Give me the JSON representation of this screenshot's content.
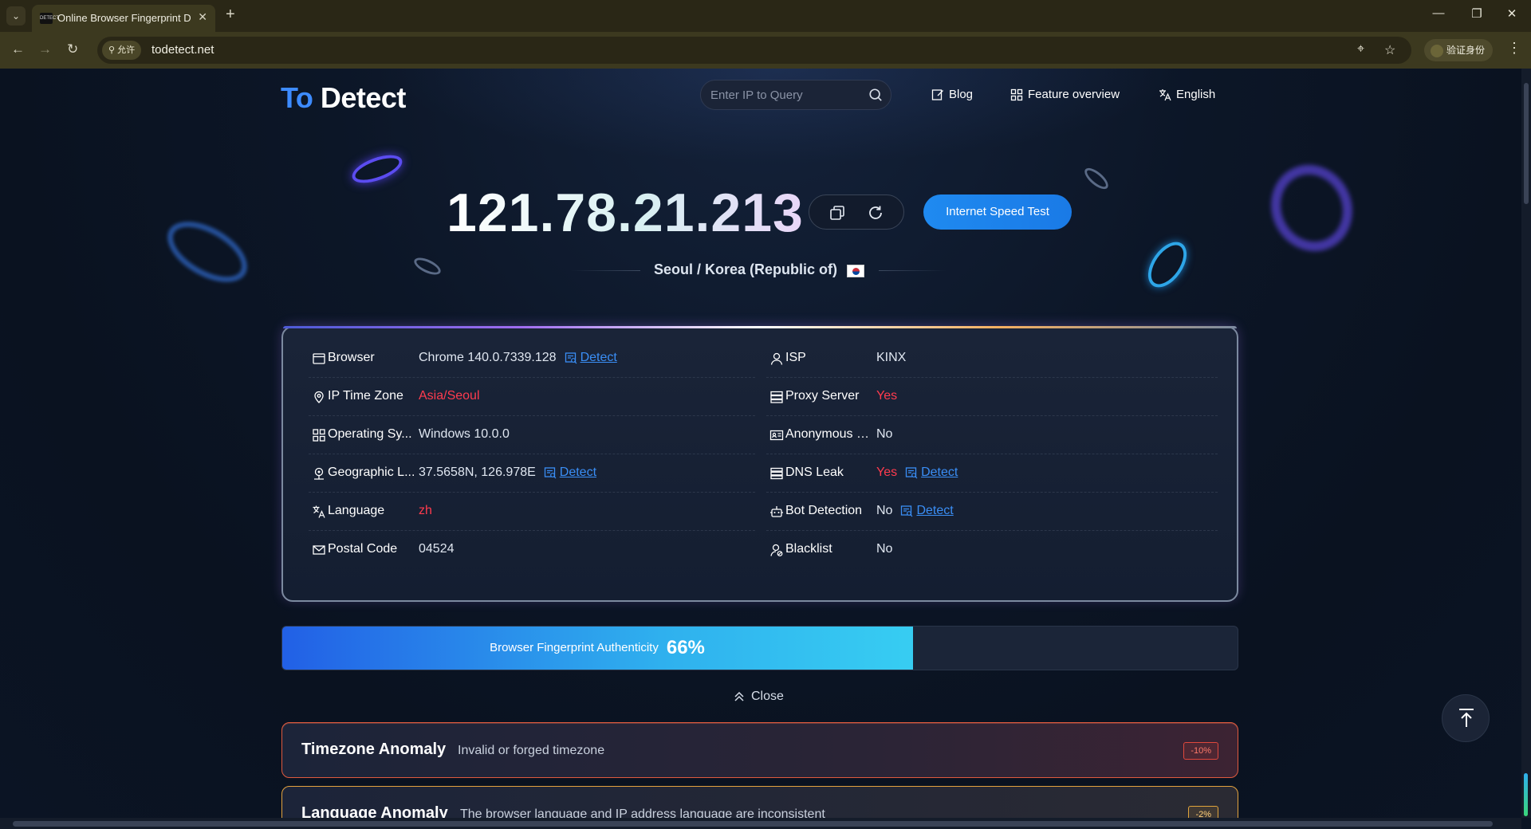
{
  "browser": {
    "tab_title": "Online Browser Fingerprint D",
    "tab_favicon_text": "DETECT",
    "site_permission": "允许",
    "url": "todetect.net",
    "verify_label": "验证身份"
  },
  "header": {
    "logo_to": "To",
    "logo_detect": "Detect",
    "search_placeholder": "Enter IP to Query",
    "nav": {
      "blog": "Blog",
      "features": "Feature overview",
      "language": "English"
    }
  },
  "hero": {
    "ip": "121.78.21.213",
    "location": "Seoul / Korea (Republic of)",
    "speed_test": "Internet Speed Test"
  },
  "info": {
    "left": [
      {
        "icon": "browser-icon",
        "label": "Browser",
        "value": "Chrome 140.0.7339.128",
        "detect": "Detect",
        "red": false
      },
      {
        "icon": "location-pin-icon",
        "label": "IP Time Zone",
        "value": "Asia/Seoul",
        "red": true
      },
      {
        "icon": "grid-icon",
        "label": "Operating Sy...",
        "value": "Windows 10.0.0",
        "red": false
      },
      {
        "icon": "map-pin-icon",
        "label": "Geographic L...",
        "value": "37.5658N, 126.978E",
        "detect": "Detect",
        "red": false
      },
      {
        "icon": "translate-icon",
        "label": "Language",
        "value": "zh",
        "red": true
      },
      {
        "icon": "mail-icon",
        "label": "Postal Code",
        "value": "04524",
        "red": false
      }
    ],
    "right": [
      {
        "icon": "user-icon",
        "label": "ISP",
        "value": "KINX",
        "red": false
      },
      {
        "icon": "server-icon",
        "label": "Proxy Server",
        "value": "Yes",
        "red": true
      },
      {
        "icon": "id-card-icon",
        "label": "Anonymous S...",
        "value": "No",
        "red": false
      },
      {
        "icon": "database-icon",
        "label": "DNS Leak",
        "value": "Yes",
        "detect": "Detect",
        "red": true
      },
      {
        "icon": "robot-icon",
        "label": "Bot Detection",
        "value": "No",
        "detect": "Detect",
        "red": false
      },
      {
        "icon": "user-block-icon",
        "label": "Blacklist",
        "value": "No",
        "red": false
      }
    ]
  },
  "authenticity": {
    "label": "Browser Fingerprint Authenticity",
    "percent_text": "66%",
    "percent": 66
  },
  "toggle": {
    "close": "Close"
  },
  "anomalies": [
    {
      "title": "Timezone Anomaly",
      "desc": "Invalid or forged timezone",
      "badge": "-10%"
    },
    {
      "title": "Language Anomaly",
      "desc": "The browser language and IP address language are inconsistent",
      "badge": "-2%"
    }
  ],
  "colors": {
    "accent": "#1f8af0",
    "danger": "#ff3b4e",
    "link": "#3a8ef5"
  }
}
